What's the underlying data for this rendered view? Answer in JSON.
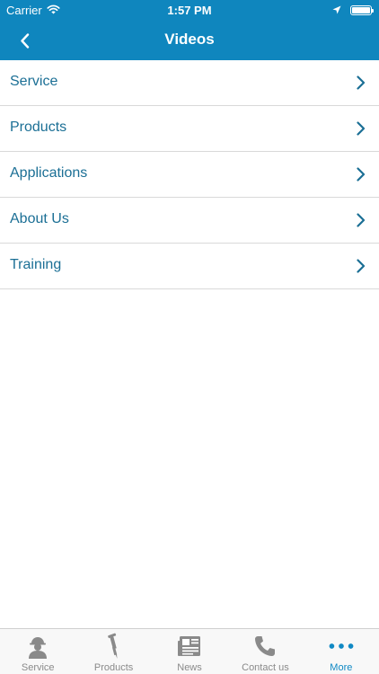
{
  "status_bar": {
    "carrier": "Carrier",
    "time": "1:57 PM"
  },
  "nav": {
    "title": "Videos"
  },
  "list": {
    "items": [
      {
        "label": "Service"
      },
      {
        "label": "Products"
      },
      {
        "label": "Applications"
      },
      {
        "label": "About Us"
      },
      {
        "label": "Training"
      }
    ]
  },
  "tabbar": {
    "tabs": [
      {
        "label": "Service",
        "icon": "worker-icon"
      },
      {
        "label": "Products",
        "icon": "jackhammer-icon"
      },
      {
        "label": "News",
        "icon": "newspaper-icon"
      },
      {
        "label": "Contact us",
        "icon": "phone-icon"
      },
      {
        "label": "More",
        "icon": "more-dots-icon",
        "active": true
      }
    ]
  },
  "colors": {
    "header": "#0f86be",
    "link_text": "#1b6f95",
    "tab_active": "#1089c4",
    "tab_inactive": "#8a8a8a"
  }
}
